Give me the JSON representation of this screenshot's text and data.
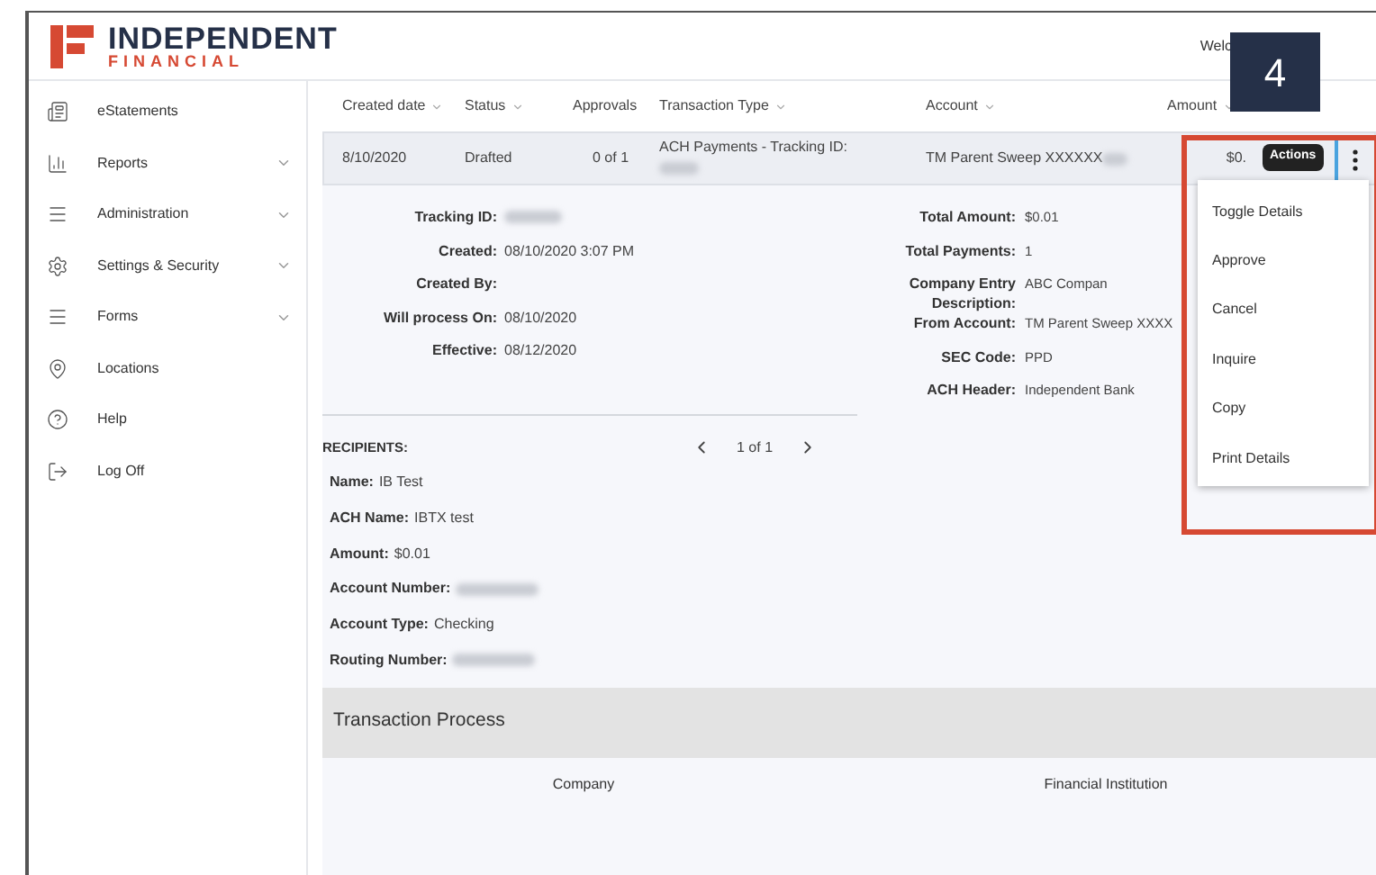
{
  "logo": {
    "name": "INDEPENDENT",
    "tagline": "FINANCIAL"
  },
  "header": {
    "welcome": "Welc"
  },
  "step_badge": "4",
  "sidebar": {
    "items": [
      {
        "label": "eStatements",
        "expandable": false
      },
      {
        "label": "Reports",
        "expandable": true
      },
      {
        "label": "Administration",
        "expandable": true
      },
      {
        "label": "Settings & Security",
        "expandable": true
      },
      {
        "label": "Forms",
        "expandable": true
      },
      {
        "label": "Locations",
        "expandable": false
      },
      {
        "label": "Help",
        "expandable": false
      },
      {
        "label": "Log Off",
        "expandable": false
      }
    ]
  },
  "table": {
    "columns": [
      {
        "label": "Created date",
        "sortable": true
      },
      {
        "label": "Status",
        "sortable": true
      },
      {
        "label": "Approvals",
        "sortable": false
      },
      {
        "label": "Transaction Type",
        "sortable": true
      },
      {
        "label": "Account",
        "sortable": true
      },
      {
        "label": "Amount",
        "sortable": true
      }
    ],
    "row": {
      "created_date": "8/10/2020",
      "status": "Drafted",
      "approvals": "0 of 1",
      "transaction_type": "ACH Payments - Tracking ID:",
      "transaction_type_redacted": true,
      "account": "TM Parent Sweep XXXXXX",
      "account_redacted": true,
      "amount": "$0."
    }
  },
  "actions_tooltip": "Actions",
  "actions_menu": {
    "highlighted": true,
    "items": [
      "Toggle Details",
      "Approve",
      "Cancel",
      "Inquire",
      "Copy",
      "Print Details"
    ]
  },
  "details": {
    "left": [
      {
        "label": "Tracking ID:",
        "redacted": true
      },
      {
        "label": "Created:",
        "value": "08/10/2020 3:07 PM",
        "redacted": false
      },
      {
        "label": "Created By:",
        "redacted": false
      },
      {
        "label": "Will process On:",
        "value": "08/10/2020",
        "redacted": false
      },
      {
        "label": "Effective:",
        "value": "08/12/2020",
        "redacted": false
      }
    ],
    "right": [
      {
        "label": "Total Amount:",
        "value": "$0.01"
      },
      {
        "label": "Total Payments:",
        "value": "1"
      },
      {
        "label": "Company Entry Description:",
        "value": "ABC Compan"
      },
      {
        "label": "From Account:",
        "value": "TM Parent Sweep XXXX"
      },
      {
        "label": "SEC Code:",
        "value": "PPD"
      },
      {
        "label": "ACH Header:",
        "value": "Independent Bank"
      }
    ]
  },
  "recipients": {
    "title": "RECIPIENTS:",
    "pager": "1 of 1",
    "fields": [
      {
        "label": "Name:",
        "value": "IB Test",
        "redacted": false
      },
      {
        "label": "ACH Name:",
        "value": "IBTX test",
        "redacted": false
      },
      {
        "label": "Amount:",
        "value": "$0.01",
        "redacted": false
      },
      {
        "label": "Account Number:",
        "redacted": true
      },
      {
        "label": "Account Type:",
        "value": "Checking",
        "redacted": false
      },
      {
        "label": "Routing Number:",
        "redacted": true
      }
    ]
  },
  "transaction_process": {
    "title": "Transaction Process",
    "columns": [
      "Company",
      "Financial Institution"
    ]
  }
}
